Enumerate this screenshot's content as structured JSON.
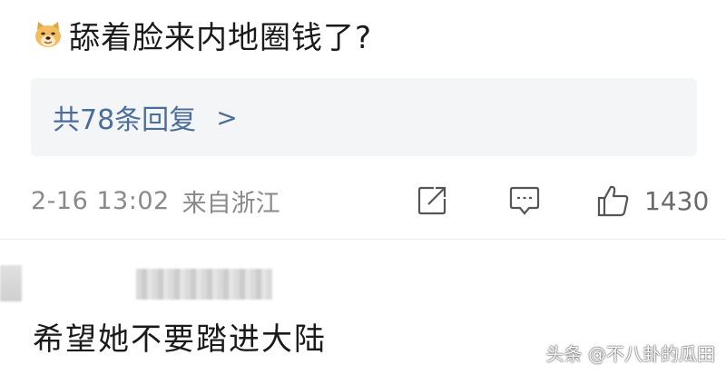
{
  "comment1": {
    "emoji": "doge-icon",
    "text": "舔着脸来内地圈钱了?"
  },
  "replies": {
    "label": "共78条回复",
    "chevron": ">"
  },
  "meta": {
    "time": "2-16 13:02",
    "location": "来自浙江",
    "like_count": "1430"
  },
  "comment2": {
    "text": "希望她不要踏进大陆"
  },
  "watermark": "头条 @不八卦的瓜田",
  "colors": {
    "link": "#4a6d9a",
    "meta": "#8a8a8a",
    "reply_bg": "#f4f5f7"
  }
}
